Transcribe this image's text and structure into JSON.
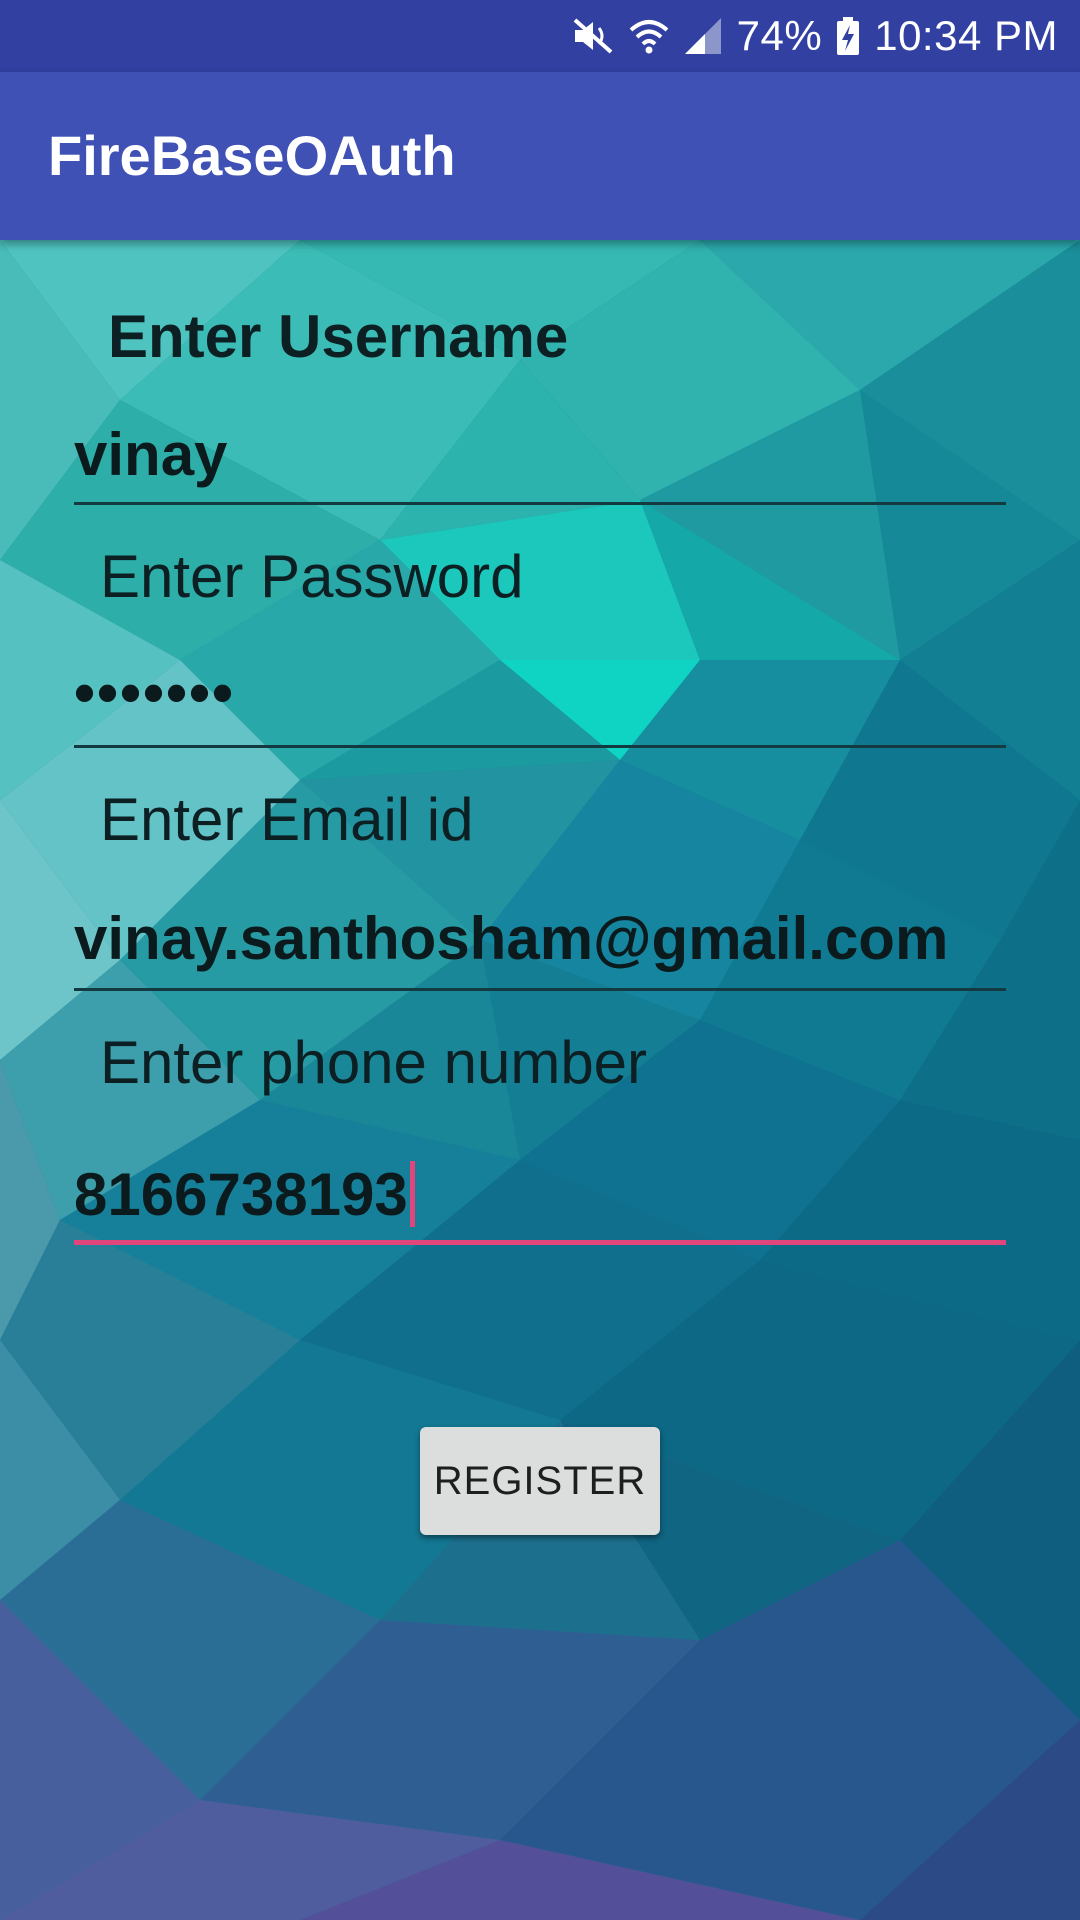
{
  "status_bar": {
    "battery": "74%",
    "time": "10:34 PM",
    "icons": [
      "mute-vibrate-icon",
      "wifi-icon",
      "cellular-signal-icon",
      "battery-charging-icon"
    ]
  },
  "app_bar": {
    "title": "FireBaseOAuth"
  },
  "form": {
    "username": {
      "label": "Enter Username",
      "value": "vinay"
    },
    "password": {
      "label": "Enter Password",
      "value": "•••••••"
    },
    "email": {
      "label": "Enter Email id",
      "value": "vinay.santhosham@gmail.com"
    },
    "phone": {
      "label": "Enter phone number",
      "value": "8166738193"
    },
    "register_label": "REGISTER"
  },
  "colors": {
    "status_bar": "#3140a1",
    "app_bar": "#3f51b5",
    "accent": "#e0467c",
    "button": "#dcdedd"
  }
}
